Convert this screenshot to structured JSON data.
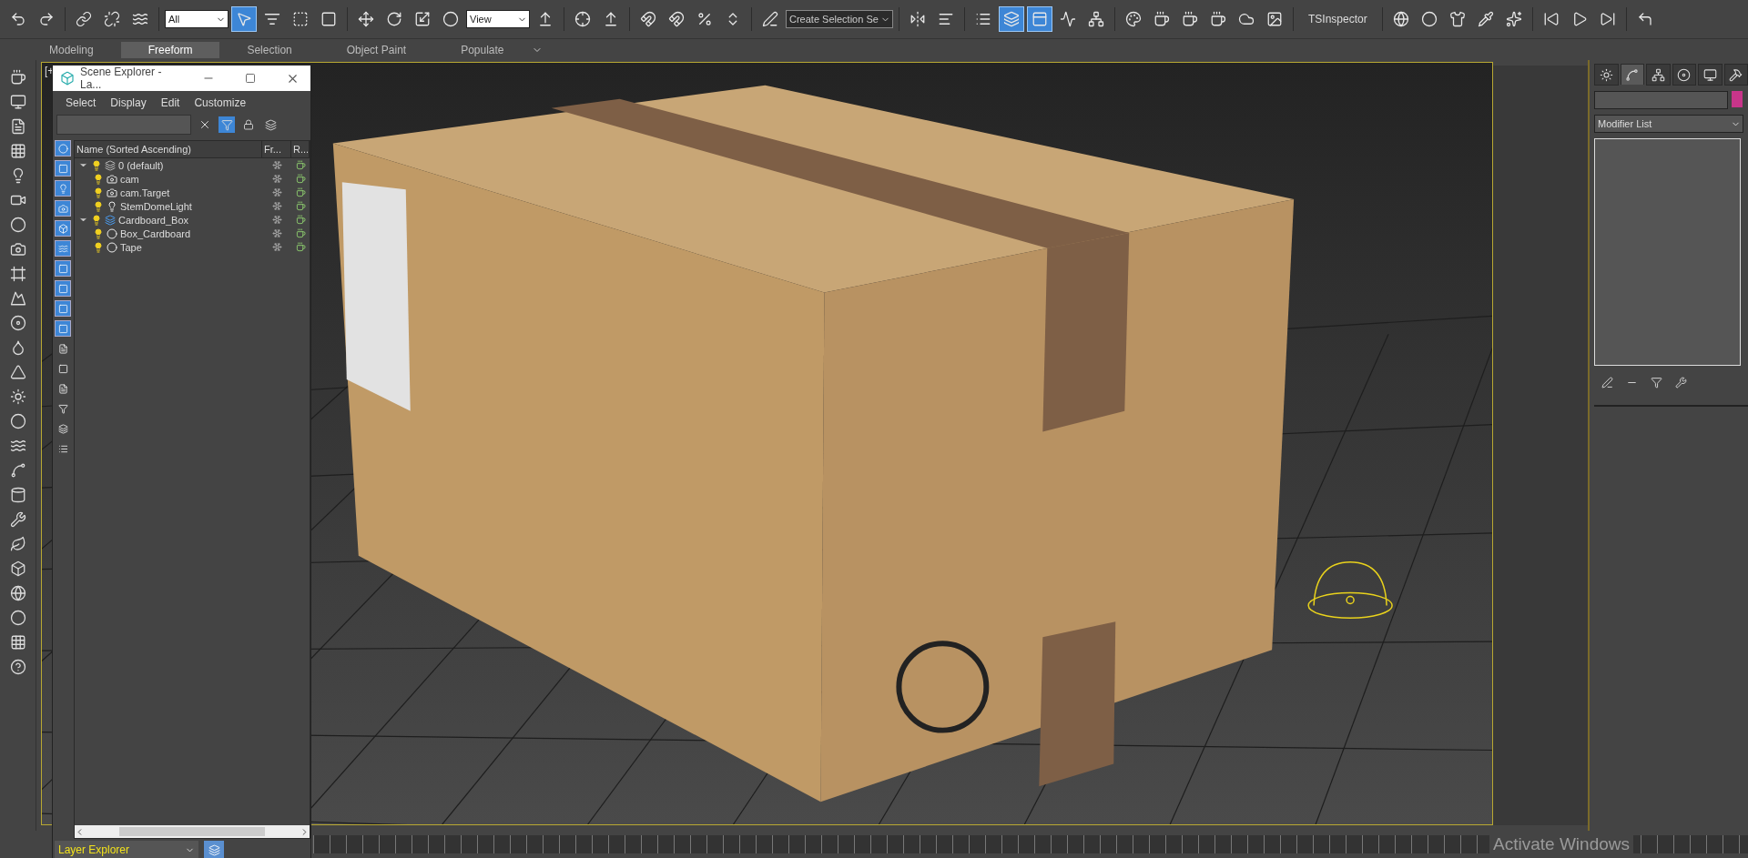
{
  "toolbar": [
    {
      "kind": "button",
      "selected": false
    },
    {
      "kind": "button",
      "selected": false
    },
    {
      "kind": "separator"
    },
    {
      "kind": "button",
      "selected": false
    },
    {
      "kind": "button",
      "selected": false
    },
    {
      "kind": "button",
      "selected": false
    },
    {
      "kind": "separator"
    },
    {
      "kind": "dropdown",
      "value": "All"
    },
    {
      "kind": "button",
      "selected": true
    },
    {
      "kind": "button",
      "selected": false
    },
    {
      "kind": "button",
      "selected": false
    },
    {
      "kind": "button",
      "selected": false
    },
    {
      "kind": "separator"
    },
    {
      "kind": "button",
      "selected": false
    },
    {
      "kind": "button",
      "selected": false
    },
    {
      "kind": "button",
      "selected": false
    },
    {
      "kind": "button",
      "selected": false
    },
    {
      "kind": "dropdown",
      "value": "View"
    },
    {
      "kind": "button",
      "selected": false
    },
    {
      "kind": "separator"
    },
    {
      "kind": "button",
      "selected": false
    },
    {
      "kind": "button",
      "selected": false
    },
    {
      "kind": "separator"
    },
    {
      "kind": "button",
      "selected": false
    },
    {
      "kind": "button",
      "selected": false
    },
    {
      "kind": "button",
      "selected": false
    },
    {
      "kind": "button",
      "selected": false
    },
    {
      "kind": "separator"
    },
    {
      "kind": "button",
      "selected": false
    },
    {
      "kind": "dropdown",
      "value": "Create Selection Se"
    },
    {
      "kind": "separator"
    },
    {
      "kind": "button",
      "selected": false
    },
    {
      "kind": "button",
      "selected": false
    },
    {
      "kind": "separator"
    },
    {
      "kind": "button",
      "selected": false
    },
    {
      "kind": "button",
      "selected": true
    },
    {
      "kind": "button",
      "selected": true
    },
    {
      "kind": "button",
      "selected": false
    },
    {
      "kind": "button",
      "selected": false
    },
    {
      "kind": "separator"
    },
    {
      "kind": "button",
      "selected": false
    },
    {
      "kind": "button",
      "selected": false
    },
    {
      "kind": "button",
      "selected": false
    },
    {
      "kind": "button",
      "selected": false
    },
    {
      "kind": "button",
      "selected": false
    },
    {
      "kind": "button",
      "selected": false
    },
    {
      "kind": "separator"
    },
    {
      "kind": "label",
      "text": "TSInspector"
    },
    {
      "kind": "separator"
    },
    {
      "kind": "button",
      "selected": false
    },
    {
      "kind": "button",
      "selected": false
    },
    {
      "kind": "button",
      "selected": false
    },
    {
      "kind": "button",
      "selected": false
    },
    {
      "kind": "button",
      "selected": false
    },
    {
      "kind": "separator"
    },
    {
      "kind": "button",
      "selected": false
    },
    {
      "kind": "button",
      "selected": false
    },
    {
      "kind": "button",
      "selected": false
    },
    {
      "kind": "separator"
    },
    {
      "kind": "button",
      "selected": false
    }
  ],
  "ribbon_tabs": [
    {
      "label": "Modeling",
      "selected": false
    },
    {
      "label": "Freeform",
      "selected": true
    },
    {
      "label": "Selection",
      "selected": false
    },
    {
      "label": "Object Paint",
      "selected": false
    },
    {
      "label": "Populate",
      "selected": false
    }
  ],
  "viewport": {
    "label": "[+"
  },
  "scene_explorer": {
    "title": "Scene Explorer - La...",
    "menu": [
      "Select",
      "Display",
      "Edit",
      "Customize"
    ],
    "filter_buttons": [
      {
        "selected": true
      },
      {
        "selected": true
      },
      {
        "selected": true
      },
      {
        "selected": true
      },
      {
        "selected": true
      },
      {
        "selected": true
      },
      {
        "selected": true
      },
      {
        "selected": true
      },
      {
        "selected": true
      },
      {
        "selected": true
      },
      {
        "selected": false
      },
      {
        "selected": false
      },
      {
        "selected": false
      },
      {
        "selected": false
      },
      {
        "selected": false
      },
      {
        "selected": false
      }
    ],
    "columns": [
      "Name (Sorted Ascending)",
      "Fr...",
      "R..."
    ],
    "tree": [
      {
        "name": "0 (default)",
        "kind": "layer",
        "active": false,
        "expanded": true,
        "children": [
          {
            "name": "cam",
            "kind": "camera"
          },
          {
            "name": "cam.Target",
            "kind": "camera"
          },
          {
            "name": "StemDomeLight",
            "kind": "light"
          }
        ]
      },
      {
        "name": "Cardboard_Box",
        "kind": "layer",
        "active": true,
        "expanded": true,
        "children": [
          {
            "name": "Box_Cardboard",
            "kind": "geometry"
          },
          {
            "name": "Tape",
            "kind": "geometry"
          }
        ]
      }
    ],
    "explorer_dropdown": "Layer Explorer"
  },
  "command_panel": {
    "tabs": [
      {
        "selected": false
      },
      {
        "selected": true
      },
      {
        "selected": false
      },
      {
        "selected": false
      },
      {
        "selected": false
      },
      {
        "selected": false
      }
    ],
    "color_swatch": {
      "color": "#c8358a"
    },
    "modifier_dropdown": "Modifier List"
  },
  "os_notice": "Activate Windows"
}
